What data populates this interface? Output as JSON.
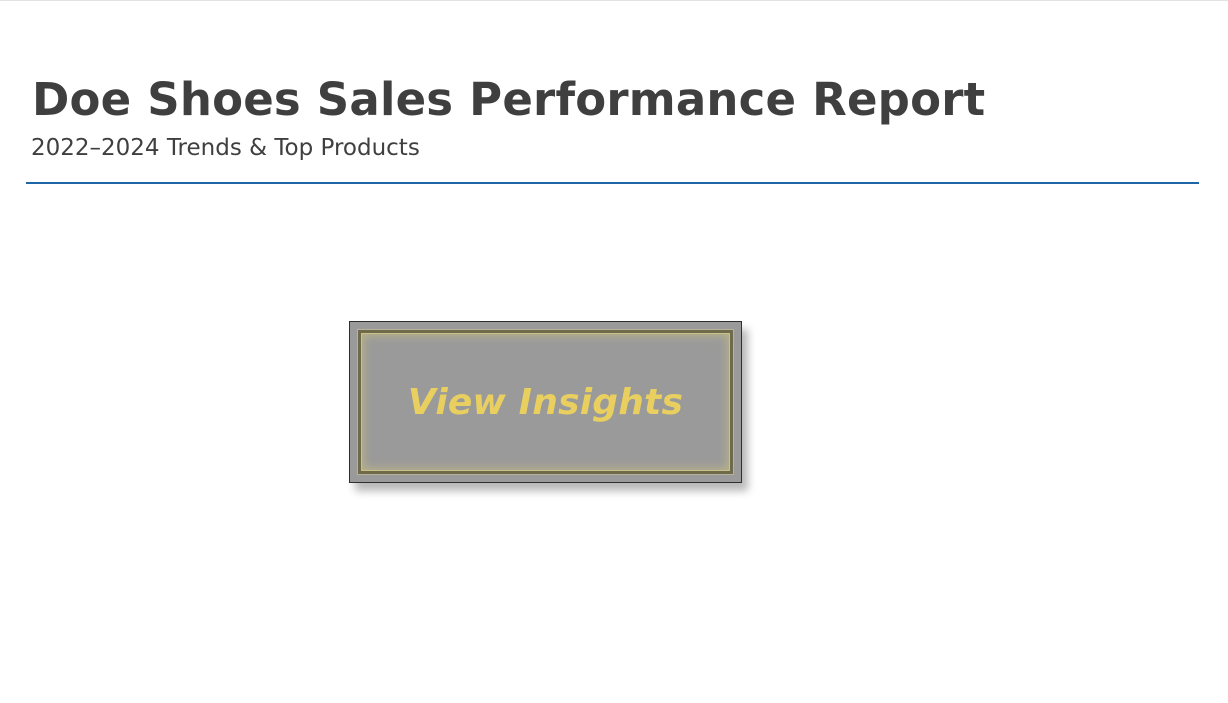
{
  "header": {
    "title": "Doe Shoes Sales Performance Report",
    "subtitle": "2022–2024 Trends & Top Products"
  },
  "main": {
    "cta_label": "View Insights"
  },
  "colors": {
    "title_text": "#3f3f3f",
    "rule": "#1f66a8",
    "button_bg": "#9a9a9a",
    "button_label": "#e8cf5f"
  }
}
